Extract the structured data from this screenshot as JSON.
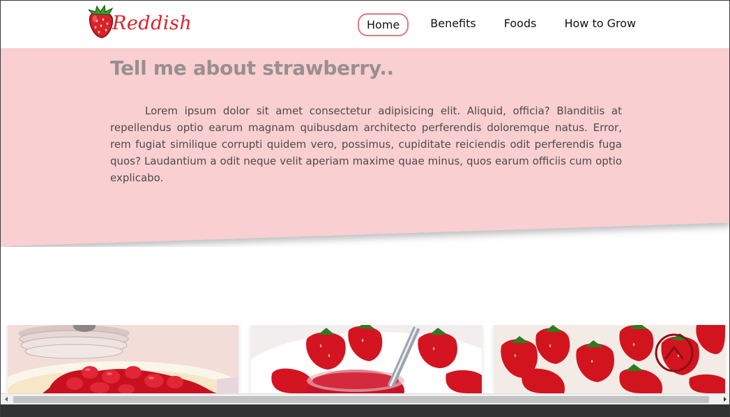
{
  "brand": {
    "name": "Reddish"
  },
  "nav": {
    "home": "Home",
    "benefits": "Benefits",
    "foods": "Foods",
    "grow": "How to Grow"
  },
  "hero": {
    "title": "Tell me about strawberry..",
    "body": "Lorem ipsum dolor sit amet consectetur adipisicing elit. Aliquid, officia? Blanditiis at repellendus optio earum magnam quibusdam architecto perferendis doloremque natus. Error, rem fugiat similique corrupti quidem vero, possimus, cupiditate reiciendis odit perferendis fuga quos? Laudantium a odit neque velit aperiam maxime quae minus, quos earum officiis cum optio explicabo."
  },
  "colors": {
    "hero_bg": "#f9cfd1",
    "brand_red": "#d8222c",
    "nav_active_border": "#d97c83",
    "title_gray": "#9a8e90"
  },
  "gallery": [
    {
      "subject": "strawberry-tart-photo"
    },
    {
      "subject": "strawberry-jam-photo"
    },
    {
      "subject": "strawberry-dessert-photo"
    }
  ]
}
